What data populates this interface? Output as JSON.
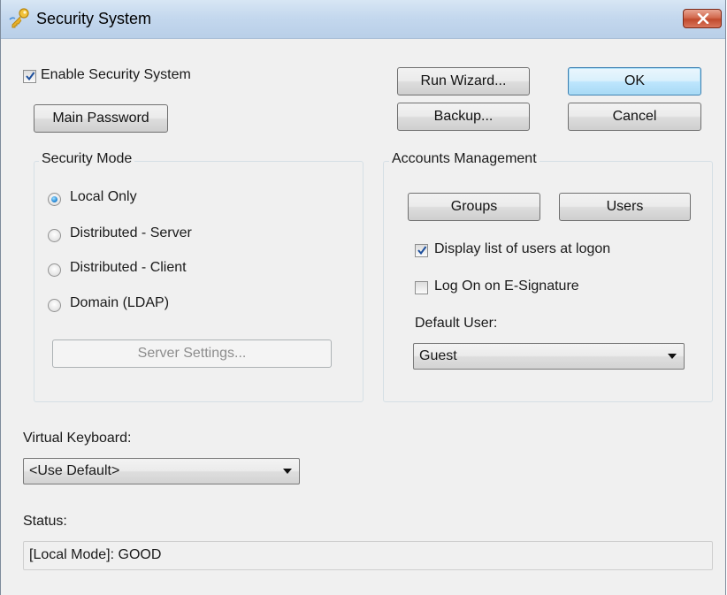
{
  "window": {
    "title": "Security System"
  },
  "enable_security": {
    "label": "Enable Security System",
    "checked": true
  },
  "buttons": {
    "main_password": "Main Password",
    "run_wizard": "Run Wizard...",
    "ok": "OK",
    "backup": "Backup...",
    "cancel": "Cancel",
    "server_settings": "Server Settings...",
    "groups": "Groups",
    "users": "Users"
  },
  "security_mode": {
    "legend": "Security Mode",
    "options": [
      {
        "label": "Local Only",
        "selected": true
      },
      {
        "label": "Distributed - Server",
        "selected": false
      },
      {
        "label": "Distributed - Client",
        "selected": false
      },
      {
        "label": "Domain (LDAP)",
        "selected": false
      }
    ]
  },
  "accounts": {
    "legend": "Accounts Management",
    "display_users": {
      "label": "Display list of users at logon",
      "checked": true
    },
    "logon_esig": {
      "label": "Log On on E-Signature",
      "checked": false
    },
    "default_user_label": "Default User:",
    "default_user_value": "Guest"
  },
  "virtual_keyboard": {
    "label": "Virtual Keyboard:",
    "value": "<Use Default>"
  },
  "status": {
    "label": "Status:",
    "value": "[Local Mode]: GOOD"
  },
  "icons": {
    "app": "key-icon",
    "close": "close-icon",
    "check": "checkmark-icon",
    "dropdown": "chevron-down-icon"
  },
  "colors": {
    "accent": "#3c7fb1",
    "close_button": "#c14a2d",
    "titlebar": "#c4d8ee"
  }
}
